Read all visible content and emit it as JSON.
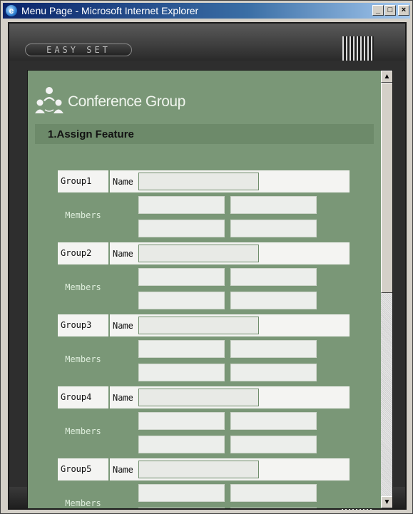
{
  "window": {
    "title": "Menu Page - Microsoft Internet Explorer",
    "min_glyph": "_",
    "max_glyph": "□",
    "close_glyph": "×",
    "ie_icon": "ie-icon"
  },
  "app": {
    "logo_text": "EASY SET"
  },
  "page": {
    "brand_title": "Conference Group",
    "brand_icon": "conference-group-icon",
    "section_title": "1.Assign Feature"
  },
  "groups": [
    {
      "label": "Group1",
      "name_label": "Name",
      "name_value": "",
      "members_label": "Members",
      "members": [
        "",
        "",
        "",
        ""
      ]
    },
    {
      "label": "Group2",
      "name_label": "Name",
      "name_value": "",
      "members_label": "Members",
      "members": [
        "",
        "",
        "",
        ""
      ]
    },
    {
      "label": "Group3",
      "name_label": "Name",
      "name_value": "",
      "members_label": "Members",
      "members": [
        "",
        "",
        "",
        ""
      ]
    },
    {
      "label": "Group4",
      "name_label": "Name",
      "name_value": "",
      "members_label": "Members",
      "members": [
        "",
        "",
        "",
        ""
      ]
    },
    {
      "label": "Group5",
      "name_label": "Name",
      "name_value": "",
      "members_label": "Members",
      "members": [
        "",
        "",
        "",
        ""
      ]
    }
  ],
  "scrollbar": {
    "up_glyph": "▲",
    "down_glyph": "▼"
  },
  "colors": {
    "content_background": "#7a9777",
    "section_bar": "#6d8a6a",
    "frame": "#2e2e2e"
  }
}
